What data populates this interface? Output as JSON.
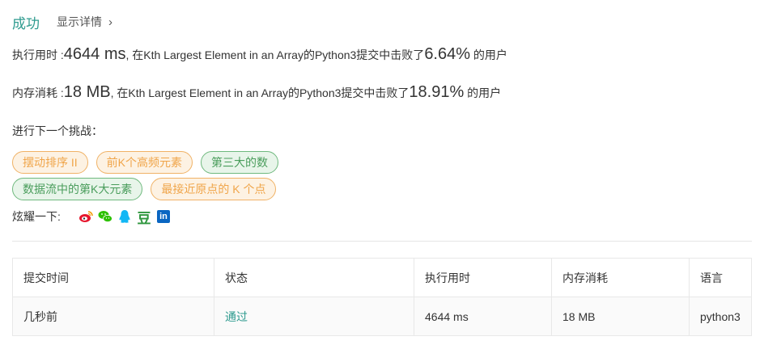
{
  "status": {
    "result": "成功",
    "detail_link": "显示详情",
    "detail_chevron": "›"
  },
  "runtime": {
    "label": "执行用时 : ",
    "value": "4644 ms",
    "mid_text": ", 在Kth Largest Element in an Array的Python3提交中击败了",
    "percent": "6.64%",
    "suffix": " 的用户"
  },
  "memory": {
    "label": "内存消耗 : ",
    "value": "18 MB",
    "mid_text": ", 在Kth Largest Element in an Array的Python3提交中击败了",
    "percent": "18.91%",
    "suffix": " 的用户"
  },
  "challenge": {
    "title": "进行下一个挑战：",
    "tags_row1": [
      {
        "label": "摆动排序 II",
        "color": "orange"
      },
      {
        "label": "前K个高频元素",
        "color": "orange"
      },
      {
        "label": "第三大的数",
        "color": "green"
      }
    ],
    "tags_row2": [
      {
        "label": "数据流中的第K大元素",
        "color": "green"
      },
      {
        "label": "最接近原点的 K 个点",
        "color": "orange"
      }
    ]
  },
  "share": {
    "label": "炫耀一下:",
    "icons": [
      "weibo-icon",
      "wechat-icon",
      "qq-icon",
      "douban-icon",
      "linkedin-icon"
    ],
    "douban_glyph": "豆",
    "linkedin_glyph": "in"
  },
  "table": {
    "headers": [
      "提交时间",
      "状态",
      "执行用时",
      "内存消耗",
      "语言"
    ],
    "rows": [
      [
        "几秒前",
        "通过",
        "4644 ms",
        "18 MB",
        "python3"
      ]
    ]
  },
  "colors": {
    "accent": "#2f9b8f",
    "tag_orange": "#f0a54a",
    "tag_green": "#4a9d5c",
    "weibo": "#e6162d",
    "wechat": "#2dc100",
    "qq": "#12b7f5",
    "douban": "#2e963d",
    "linkedin": "#0a66c2"
  }
}
